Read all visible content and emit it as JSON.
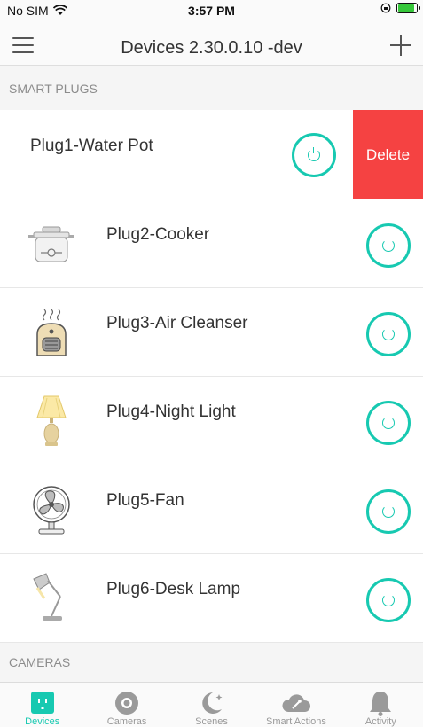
{
  "status_bar": {
    "carrier": "No SIM",
    "time": "3:57 PM"
  },
  "nav": {
    "title": "Devices 2.30.0.10 -dev"
  },
  "sections": {
    "smart_plugs": "SMART PLUGS",
    "cameras": "CAMERAS"
  },
  "plugs": [
    {
      "name": "Plug1-Water Pot",
      "delete_label": "Delete"
    },
    {
      "name": "Plug2-Cooker",
      "icon": "cooker-icon"
    },
    {
      "name": "Plug3-Air Cleanser",
      "icon": "air-cleanser-icon"
    },
    {
      "name": "Plug4-Night Light",
      "icon": "night-light-icon"
    },
    {
      "name": "Plug5-Fan",
      "icon": "fan-icon"
    },
    {
      "name": "Plug6-Desk Lamp",
      "icon": "desk-lamp-icon"
    }
  ],
  "tabs": [
    {
      "label": "Devices",
      "active": true
    },
    {
      "label": "Cameras"
    },
    {
      "label": "Scenes"
    },
    {
      "label": "Smart Actions"
    },
    {
      "label": "Activity"
    }
  ],
  "colors": {
    "accent": "#17c9b1",
    "delete": "#f54242"
  }
}
